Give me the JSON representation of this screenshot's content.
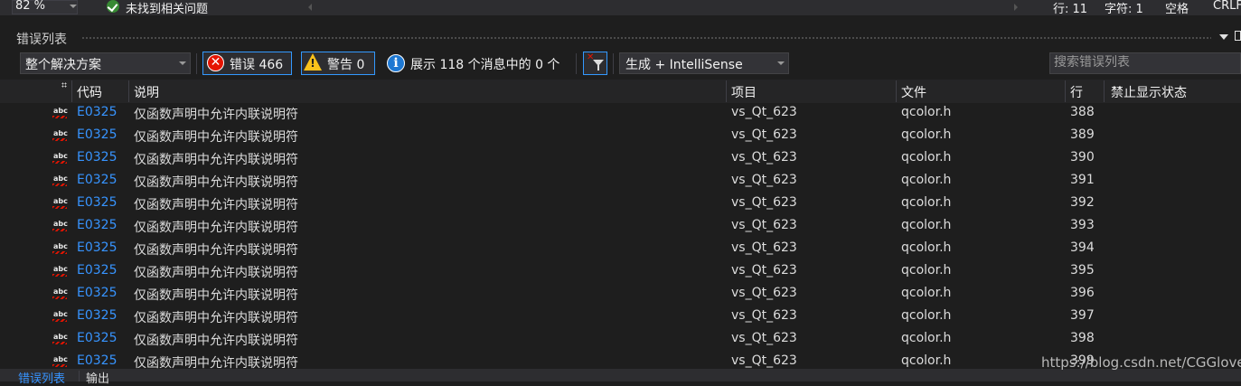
{
  "status": {
    "zoom": "82 %",
    "issues": "未找到相关问题",
    "line": "行: 11",
    "char": "字符: 1",
    "spacing": "空格",
    "eol": "CRLF"
  },
  "panel": {
    "title": "错误列表"
  },
  "toolbar": {
    "scope": "整个解决方案",
    "errors_label": "错误 466",
    "warnings_label": "警告 0",
    "messages_label": "展示 118 个消息中的 0 个",
    "build_filter": "生成 + IntelliSense",
    "search_placeholder": "搜索错误列表"
  },
  "columns": {
    "code": "代码",
    "description": "说明",
    "project": "项目",
    "file": "文件",
    "line": "行",
    "suppression": "禁止显示状态"
  },
  "rows": [
    {
      "code": "E0325",
      "description": "仅函数声明中允许内联说明符",
      "project": "vs_Qt_623",
      "file": "qcolor.h",
      "line": "388"
    },
    {
      "code": "E0325",
      "description": "仅函数声明中允许内联说明符",
      "project": "vs_Qt_623",
      "file": "qcolor.h",
      "line": "389"
    },
    {
      "code": "E0325",
      "description": "仅函数声明中允许内联说明符",
      "project": "vs_Qt_623",
      "file": "qcolor.h",
      "line": "390"
    },
    {
      "code": "E0325",
      "description": "仅函数声明中允许内联说明符",
      "project": "vs_Qt_623",
      "file": "qcolor.h",
      "line": "391"
    },
    {
      "code": "E0325",
      "description": "仅函数声明中允许内联说明符",
      "project": "vs_Qt_623",
      "file": "qcolor.h",
      "line": "392"
    },
    {
      "code": "E0325",
      "description": "仅函数声明中允许内联说明符",
      "project": "vs_Qt_623",
      "file": "qcolor.h",
      "line": "393"
    },
    {
      "code": "E0325",
      "description": "仅函数声明中允许内联说明符",
      "project": "vs_Qt_623",
      "file": "qcolor.h",
      "line": "394"
    },
    {
      "code": "E0325",
      "description": "仅函数声明中允许内联说明符",
      "project": "vs_Qt_623",
      "file": "qcolor.h",
      "line": "395"
    },
    {
      "code": "E0325",
      "description": "仅函数声明中允许内联说明符",
      "project": "vs_Qt_623",
      "file": "qcolor.h",
      "line": "396"
    },
    {
      "code": "E0325",
      "description": "仅函数声明中允许内联说明符",
      "project": "vs_Qt_623",
      "file": "qcolor.h",
      "line": "397"
    },
    {
      "code": "E0325",
      "description": "仅函数声明中允许内联说明符",
      "project": "vs_Qt_623",
      "file": "qcolor.h",
      "line": "398"
    },
    {
      "code": "E0325",
      "description": "仅函数声明中允许内联说明符",
      "project": "vs_Qt_623",
      "file": "qcolor.h",
      "line": "399"
    }
  ],
  "row_icon": "abc-squiggle-icon",
  "bottom_tabs": {
    "errors": "错误列表",
    "output": "输出"
  },
  "watermark": "https://blog.csdn.net/CGGlove",
  "colors": {
    "background": "#1e1e1e",
    "accent": "#3399ff",
    "link": "#3794ff",
    "error": "#e51400",
    "warning": "#f9c21b",
    "info": "#1e78d2",
    "ok": "#388a34"
  }
}
